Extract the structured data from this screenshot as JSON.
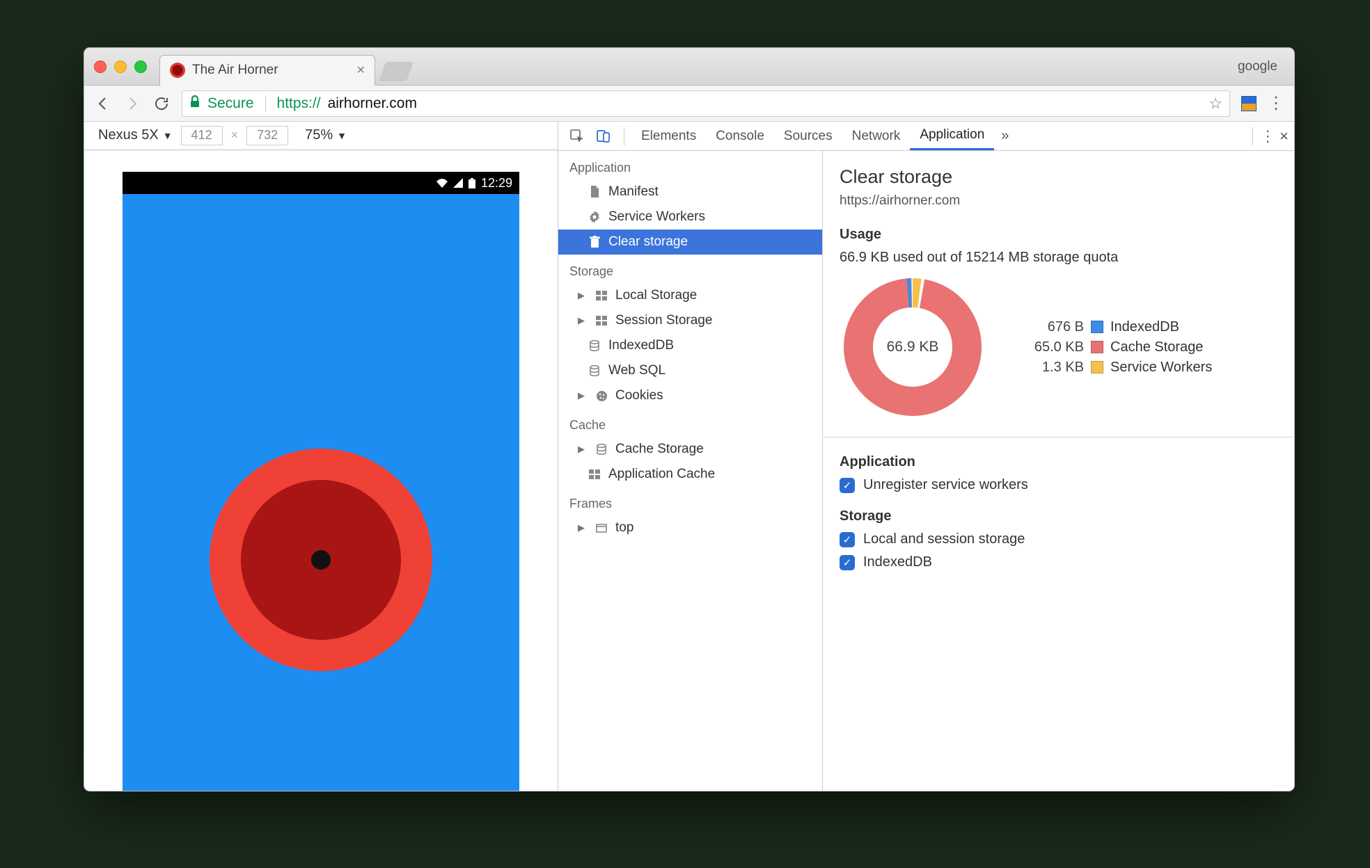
{
  "tab": {
    "title": "The Air Horner"
  },
  "titlebar": {
    "google_label": "google"
  },
  "addressbar": {
    "secure": "Secure",
    "proto": "https://",
    "host": "airhorner.com"
  },
  "device_bar": {
    "device": "Nexus 5X",
    "width": "412",
    "height": "732",
    "zoom": "75%"
  },
  "phone": {
    "time": "12:29"
  },
  "devtools_tabs": {
    "elements": "Elements",
    "console": "Console",
    "sources": "Sources",
    "network": "Network",
    "application": "Application"
  },
  "sidebar": {
    "groups": {
      "application": "Application",
      "storage": "Storage",
      "cache": "Cache",
      "frames": "Frames"
    },
    "application_items": {
      "manifest": "Manifest",
      "service_workers": "Service Workers",
      "clear_storage": "Clear storage"
    },
    "storage_items": {
      "local_storage": "Local Storage",
      "session_storage": "Session Storage",
      "indexeddb": "IndexedDB",
      "web_sql": "Web SQL",
      "cookies": "Cookies"
    },
    "cache_items": {
      "cache_storage": "Cache Storage",
      "application_cache": "Application Cache"
    },
    "frames_items": {
      "top": "top"
    }
  },
  "right_panel": {
    "title": "Clear storage",
    "origin": "https://airhorner.com",
    "usage_head": "Usage",
    "usage_text": "66.9 KB used out of 15214 MB storage quota",
    "donut_center": "66.9 KB",
    "legend": {
      "indexeddb_size": "676 B",
      "indexeddb_label": "IndexedDB",
      "cache_size": "65.0 KB",
      "cache_label": "Cache Storage",
      "sw_size": "1.3 KB",
      "sw_label": "Service Workers"
    },
    "app_head": "Application",
    "unregister_sw": "Unregister service workers",
    "storage_head": "Storage",
    "cb_local_session": "Local and session storage",
    "cb_indexeddb": "IndexedDB"
  },
  "chart_data": {
    "type": "pie",
    "title": "Storage usage breakdown",
    "total_label": "66.9 KB",
    "series": [
      {
        "name": "IndexedDB",
        "value_bytes": 676,
        "display": "676 B",
        "color": "#3c8de4"
      },
      {
        "name": "Cache Storage",
        "value_bytes": 66560,
        "display": "65.0 KB",
        "color": "#e97272"
      },
      {
        "name": "Service Workers",
        "value_bytes": 1331,
        "display": "1.3 KB",
        "color": "#f2c14e"
      }
    ]
  }
}
